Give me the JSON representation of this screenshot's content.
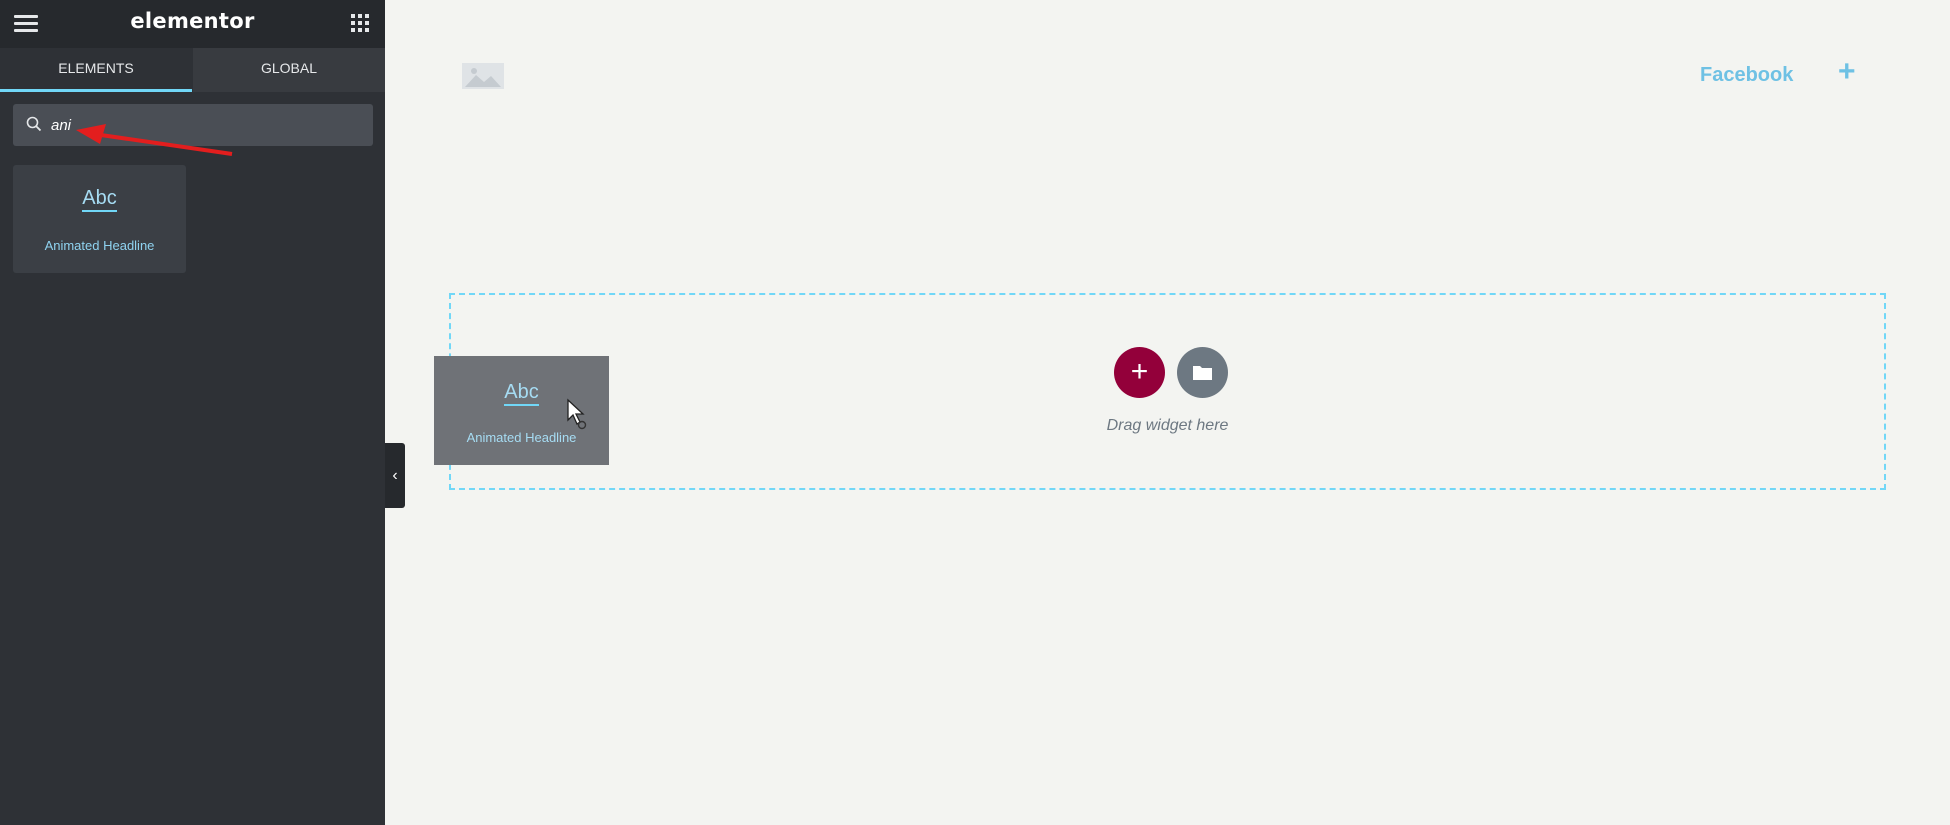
{
  "app": {
    "logo": "elementor"
  },
  "tabs": [
    {
      "label": "ELEMENTS",
      "active": true
    },
    {
      "label": "GLOBAL",
      "active": false
    }
  ],
  "search": {
    "value": "ani",
    "placeholder": ""
  },
  "widgets": [
    {
      "icon": "Abc",
      "label": "Animated Headline",
      "icon_name": "animated-headline-icon"
    }
  ],
  "canvas": {
    "social_link": "Facebook",
    "add_icon": "+",
    "drop_text": "Drag widget here",
    "add_button": "+"
  },
  "dragging": {
    "icon": "Abc",
    "label": "Animated Headline"
  },
  "colors": {
    "accent": "#71d7f7",
    "add_button": "#93003a",
    "sidebar_bg": "#2e3136",
    "annotation_arrow": "#e31e1e"
  }
}
